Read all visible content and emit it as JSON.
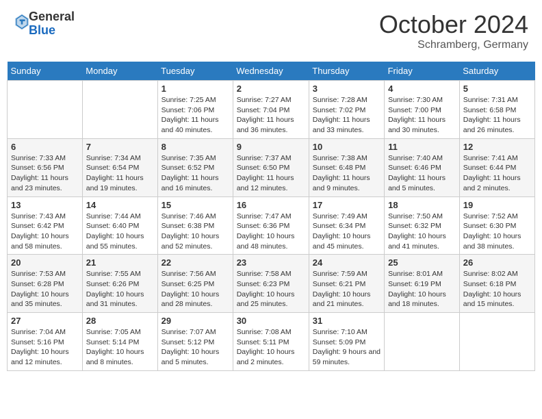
{
  "header": {
    "logo_general": "General",
    "logo_blue": "Blue",
    "month_title": "October 2024",
    "location": "Schramberg, Germany"
  },
  "days_of_week": [
    "Sunday",
    "Monday",
    "Tuesday",
    "Wednesday",
    "Thursday",
    "Friday",
    "Saturday"
  ],
  "weeks": [
    [
      {
        "day": "",
        "sunrise": "",
        "sunset": "",
        "daylight": ""
      },
      {
        "day": "",
        "sunrise": "",
        "sunset": "",
        "daylight": ""
      },
      {
        "day": "1",
        "sunrise": "Sunrise: 7:25 AM",
        "sunset": "Sunset: 7:06 PM",
        "daylight": "Daylight: 11 hours and 40 minutes."
      },
      {
        "day": "2",
        "sunrise": "Sunrise: 7:27 AM",
        "sunset": "Sunset: 7:04 PM",
        "daylight": "Daylight: 11 hours and 36 minutes."
      },
      {
        "day": "3",
        "sunrise": "Sunrise: 7:28 AM",
        "sunset": "Sunset: 7:02 PM",
        "daylight": "Daylight: 11 hours and 33 minutes."
      },
      {
        "day": "4",
        "sunrise": "Sunrise: 7:30 AM",
        "sunset": "Sunset: 7:00 PM",
        "daylight": "Daylight: 11 hours and 30 minutes."
      },
      {
        "day": "5",
        "sunrise": "Sunrise: 7:31 AM",
        "sunset": "Sunset: 6:58 PM",
        "daylight": "Daylight: 11 hours and 26 minutes."
      }
    ],
    [
      {
        "day": "6",
        "sunrise": "Sunrise: 7:33 AM",
        "sunset": "Sunset: 6:56 PM",
        "daylight": "Daylight: 11 hours and 23 minutes."
      },
      {
        "day": "7",
        "sunrise": "Sunrise: 7:34 AM",
        "sunset": "Sunset: 6:54 PM",
        "daylight": "Daylight: 11 hours and 19 minutes."
      },
      {
        "day": "8",
        "sunrise": "Sunrise: 7:35 AM",
        "sunset": "Sunset: 6:52 PM",
        "daylight": "Daylight: 11 hours and 16 minutes."
      },
      {
        "day": "9",
        "sunrise": "Sunrise: 7:37 AM",
        "sunset": "Sunset: 6:50 PM",
        "daylight": "Daylight: 11 hours and 12 minutes."
      },
      {
        "day": "10",
        "sunrise": "Sunrise: 7:38 AM",
        "sunset": "Sunset: 6:48 PM",
        "daylight": "Daylight: 11 hours and 9 minutes."
      },
      {
        "day": "11",
        "sunrise": "Sunrise: 7:40 AM",
        "sunset": "Sunset: 6:46 PM",
        "daylight": "Daylight: 11 hours and 5 minutes."
      },
      {
        "day": "12",
        "sunrise": "Sunrise: 7:41 AM",
        "sunset": "Sunset: 6:44 PM",
        "daylight": "Daylight: 11 hours and 2 minutes."
      }
    ],
    [
      {
        "day": "13",
        "sunrise": "Sunrise: 7:43 AM",
        "sunset": "Sunset: 6:42 PM",
        "daylight": "Daylight: 10 hours and 58 minutes."
      },
      {
        "day": "14",
        "sunrise": "Sunrise: 7:44 AM",
        "sunset": "Sunset: 6:40 PM",
        "daylight": "Daylight: 10 hours and 55 minutes."
      },
      {
        "day": "15",
        "sunrise": "Sunrise: 7:46 AM",
        "sunset": "Sunset: 6:38 PM",
        "daylight": "Daylight: 10 hours and 52 minutes."
      },
      {
        "day": "16",
        "sunrise": "Sunrise: 7:47 AM",
        "sunset": "Sunset: 6:36 PM",
        "daylight": "Daylight: 10 hours and 48 minutes."
      },
      {
        "day": "17",
        "sunrise": "Sunrise: 7:49 AM",
        "sunset": "Sunset: 6:34 PM",
        "daylight": "Daylight: 10 hours and 45 minutes."
      },
      {
        "day": "18",
        "sunrise": "Sunrise: 7:50 AM",
        "sunset": "Sunset: 6:32 PM",
        "daylight": "Daylight: 10 hours and 41 minutes."
      },
      {
        "day": "19",
        "sunrise": "Sunrise: 7:52 AM",
        "sunset": "Sunset: 6:30 PM",
        "daylight": "Daylight: 10 hours and 38 minutes."
      }
    ],
    [
      {
        "day": "20",
        "sunrise": "Sunrise: 7:53 AM",
        "sunset": "Sunset: 6:28 PM",
        "daylight": "Daylight: 10 hours and 35 minutes."
      },
      {
        "day": "21",
        "sunrise": "Sunrise: 7:55 AM",
        "sunset": "Sunset: 6:26 PM",
        "daylight": "Daylight: 10 hours and 31 minutes."
      },
      {
        "day": "22",
        "sunrise": "Sunrise: 7:56 AM",
        "sunset": "Sunset: 6:25 PM",
        "daylight": "Daylight: 10 hours and 28 minutes."
      },
      {
        "day": "23",
        "sunrise": "Sunrise: 7:58 AM",
        "sunset": "Sunset: 6:23 PM",
        "daylight": "Daylight: 10 hours and 25 minutes."
      },
      {
        "day": "24",
        "sunrise": "Sunrise: 7:59 AM",
        "sunset": "Sunset: 6:21 PM",
        "daylight": "Daylight: 10 hours and 21 minutes."
      },
      {
        "day": "25",
        "sunrise": "Sunrise: 8:01 AM",
        "sunset": "Sunset: 6:19 PM",
        "daylight": "Daylight: 10 hours and 18 minutes."
      },
      {
        "day": "26",
        "sunrise": "Sunrise: 8:02 AM",
        "sunset": "Sunset: 6:18 PM",
        "daylight": "Daylight: 10 hours and 15 minutes."
      }
    ],
    [
      {
        "day": "27",
        "sunrise": "Sunrise: 7:04 AM",
        "sunset": "Sunset: 5:16 PM",
        "daylight": "Daylight: 10 hours and 12 minutes."
      },
      {
        "day": "28",
        "sunrise": "Sunrise: 7:05 AM",
        "sunset": "Sunset: 5:14 PM",
        "daylight": "Daylight: 10 hours and 8 minutes."
      },
      {
        "day": "29",
        "sunrise": "Sunrise: 7:07 AM",
        "sunset": "Sunset: 5:12 PM",
        "daylight": "Daylight: 10 hours and 5 minutes."
      },
      {
        "day": "30",
        "sunrise": "Sunrise: 7:08 AM",
        "sunset": "Sunset: 5:11 PM",
        "daylight": "Daylight: 10 hours and 2 minutes."
      },
      {
        "day": "31",
        "sunrise": "Sunrise: 7:10 AM",
        "sunset": "Sunset: 5:09 PM",
        "daylight": "Daylight: 9 hours and 59 minutes."
      },
      {
        "day": "",
        "sunrise": "",
        "sunset": "",
        "daylight": ""
      },
      {
        "day": "",
        "sunrise": "",
        "sunset": "",
        "daylight": ""
      }
    ]
  ]
}
